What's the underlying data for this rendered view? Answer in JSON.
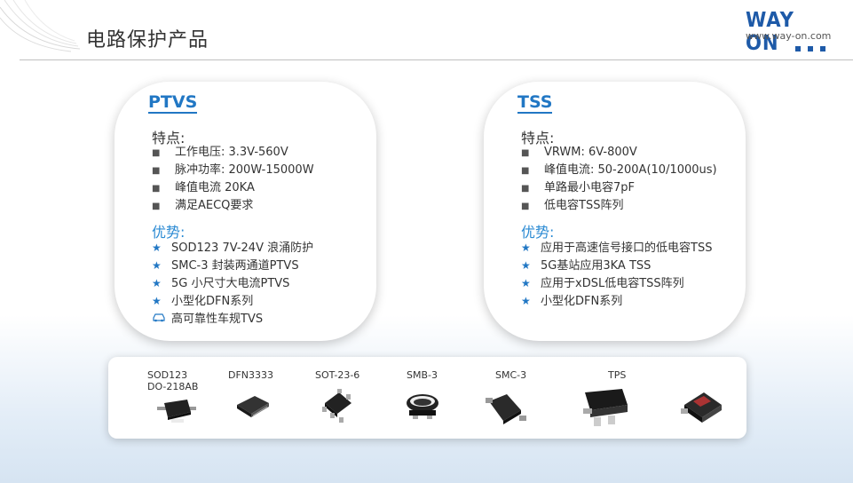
{
  "page": {
    "title": "电路保护产品"
  },
  "logo": {
    "text": "WAY ON",
    "url": "www.way-on.com"
  },
  "ptvs": {
    "heading": "PTVS",
    "features_title": "特点:",
    "features": [
      "工作电压: 3.3V-560V",
      "脉冲功率: 200W-15000W",
      "峰值电流 20KA",
      "满足AECQ要求"
    ],
    "advantages_title": "优势:",
    "advantages": [
      "SOD123 7V-24V 浪涌防护",
      "SMC-3 封装两通道PTVS",
      "5G 小尺寸大电流PTVS",
      "小型化DFN系列",
      "高可靠性车规TVS"
    ]
  },
  "tss": {
    "heading": "TSS",
    "features_title": "特点:",
    "features": [
      "VRWM: 6V-800V",
      "峰值电流: 50-200A(10/1000us)",
      "单路最小电容7pF",
      "低电容TSS阵列"
    ],
    "advantages_title": "优势:",
    "advantages": [
      "应用于高速信号接口的低电容TSS",
      "5G基站应用3KA TSS",
      "应用于xDSL低电容TSS阵列",
      "小型化DFN系列"
    ]
  },
  "packages": [
    {
      "line1": "SOD123",
      "line2": "DO-218AB"
    },
    {
      "line1": "DFN3333",
      "line2": ""
    },
    {
      "line1": "SOT-23-6",
      "line2": ""
    },
    {
      "line1": "SMB-3",
      "line2": ""
    },
    {
      "line1": "SMC-3",
      "line2": ""
    },
    {
      "line1": "TPS",
      "line2": ""
    }
  ],
  "colors": {
    "accent": "#2177c4",
    "brand": "#1e5aa8"
  }
}
